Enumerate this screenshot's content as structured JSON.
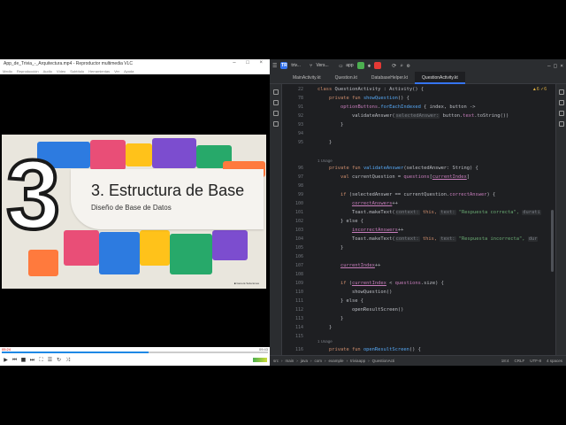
{
  "vlc": {
    "title": "App_de_Trivia_-_Arquitectura.mp4 - Reproductor multimedia VLC",
    "menu": [
      "Medio",
      "Reproducción",
      "Audio",
      "Vídeo",
      "Subtítulo",
      "Herramientas",
      "Ver",
      "Ayuda"
    ],
    "elapsed": "05:24",
    "total": "09:43",
    "progress": 0.55,
    "win_controls": "–  □  ×"
  },
  "slide": {
    "number": "3",
    "title": "3. Estructura de Base",
    "subtitle": "Diseño de Base de Datos",
    "brand": "■ Genera Soluciones"
  },
  "ide": {
    "project_badge": "TR",
    "project_name": "triv...",
    "module": "Vers...",
    "run_config": "app",
    "tabs": [
      "MainActivity.kt",
      "Question.kt",
      "DatabaseHelper.kt",
      "QuestionActivity.kt"
    ],
    "active_tab": 3,
    "warnings": "▲6  ✓6",
    "line_numbers": [
      "22",
      "78",
      "91",
      "92",
      "93",
      "94",
      "95",
      "96",
      "97",
      "98",
      "99",
      "100",
      "101",
      "102",
      "103",
      "104",
      "105",
      "106",
      "107",
      "108",
      "109",
      "110",
      "111",
      "112",
      "113",
      "114",
      "115",
      "116",
      "117",
      "118",
      "119",
      "120"
    ],
    "usage": "1 Usage",
    "status": {
      "breadcrumb": [
        "src",
        "main",
        "java",
        "com",
        "example",
        "triviaapp",
        "QuestionActi"
      ],
      "position": "18:4",
      "line_sep": "CRLF",
      "encoding": "UTF-8",
      "indent": "4 spaces"
    },
    "code": {
      "l1a": "class ",
      "l1b": "QuestionActivity : Activity() {",
      "l2a": "    private fun ",
      "l2b": "showQuestion",
      "l2c": "() {",
      "l3a": "        ",
      "l3b": "optionButtons",
      "l3c": ".",
      "l3d": "forEachIndexed",
      "l3e": " { index, button ->",
      "l4a": "            validateAnswer(",
      "l4b": "selectedAnswer:",
      "l4c": " button.",
      "l4d": "text",
      "l4e": ".toString())",
      "l5": "        }",
      "l6": "    }",
      "l7a": "    private fun ",
      "l7b": "validateAnswer",
      "l7c": "(selectedAnswer: String) {",
      "l8a": "        val ",
      "l8b": "currentQuestion = ",
      "l8c": "questions",
      "l8d": "[",
      "l8e": "currentIndex",
      "l8f": "]",
      "l9a": "        if ",
      "l9b": "(selectedAnswer == currentQuestion.",
      "l9c": "correctAnswer",
      ") {": ") {",
      "l9d": ") {",
      "l10a": "            ",
      "l10b": "correctAnswers",
      "l10c": "++",
      "l11a": "            Toast.makeText(",
      "l11b": "context:",
      "l11c": " this, ",
      "l11d": "text:",
      "l11e": " \"Respuesta correcta\", ",
      "l11f": "durati",
      "l12a": "        } else {",
      "l13a": "            ",
      "l13b": "incorrectAnswers",
      "l13c": "++",
      "l14a": "            Toast.makeText(",
      "l14b": "context:",
      "l14c": " this, ",
      "l14d": "text:",
      "l14e": " \"Respuesta incorrecta\", ",
      "l14f": "dur",
      "l15": "        }",
      "l16a": "        ",
      "l16b": "currentIndex",
      "l16c": "++",
      "l17a": "        if ",
      "l17b": "(",
      "l17c": "currentIndex",
      " < ": " < ",
      "l17d": " < ",
      "l17e": "questions",
      "l17f": ".size) {",
      "l18": "            showQuestion()",
      "l19": "        } else {",
      "l20": "            openResultScreen()",
      "l21": "        }",
      "l22": "    }",
      "l23a": "    private fun ",
      "l23b": "openResultScreen",
      "l23c": "() {"
    }
  },
  "colors": {
    "accent": "#3574f0",
    "keyword": "#cf8e6d",
    "function": "#56a8f5",
    "property": "#c77dbb",
    "string": "#6aab73"
  }
}
